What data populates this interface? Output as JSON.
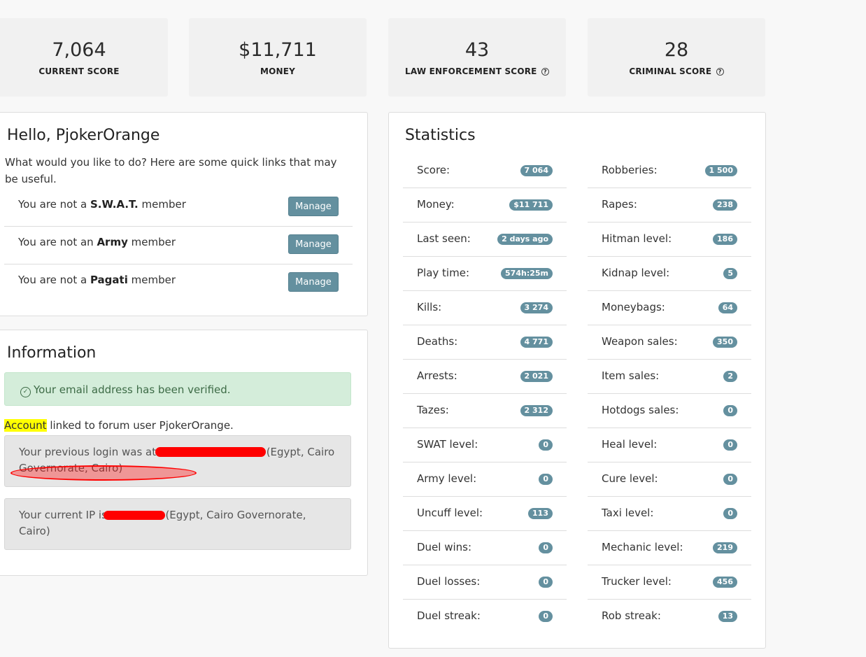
{
  "cards": [
    {
      "value": "7,064",
      "label": "CURRENT SCORE"
    },
    {
      "value": "$11,711",
      "label": "MONEY"
    },
    {
      "value": "43",
      "label": "LAW ENFORCEMENT SCORE"
    },
    {
      "value": "28",
      "label": "CRIMINAL SCORE"
    }
  ],
  "help_glyph": "?",
  "hello": {
    "title": "Hello, PjokerOrange",
    "subtitle": "What would you like to do? Here are some quick links that may be useful.",
    "memberships": [
      {
        "prefix": "You are not a ",
        "group": "S.W.A.T.",
        "suffix": " member",
        "button": "Manage"
      },
      {
        "prefix": "You are not an ",
        "group": "Army",
        "suffix": " member",
        "button": "Manage"
      },
      {
        "prefix": "You are not a ",
        "group": "Pagati",
        "suffix": " member",
        "button": "Manage"
      }
    ]
  },
  "information": {
    "title": "Information",
    "verified_text": "Your email address has been verified.",
    "account_word": "Account",
    "linked_text": " linked to forum user PjokerOrange.",
    "previous_login_prefix": "Your previous login was at",
    "previous_login_suffix": "(Egypt, Cairo Governorate, Cairo)",
    "current_ip_prefix": "Your current IP is",
    "current_ip_suffix": "(Egypt, Cairo Governorate, Cairo)"
  },
  "statistics": {
    "title": "Statistics",
    "left": [
      {
        "label": "Score:",
        "value": "7 064"
      },
      {
        "label": "Money:",
        "value": "$11 711"
      },
      {
        "label": "Last seen:",
        "value": "2 days ago"
      },
      {
        "label": "Play time:",
        "value": "574h:25m"
      },
      {
        "label": "Kills:",
        "value": "3 274"
      },
      {
        "label": "Deaths:",
        "value": "4 771"
      },
      {
        "label": "Arrests:",
        "value": "2 021"
      },
      {
        "label": "Tazes:",
        "value": "2 312"
      },
      {
        "label": "SWAT level:",
        "value": "0"
      },
      {
        "label": "Army level:",
        "value": "0"
      },
      {
        "label": "Uncuff level:",
        "value": "113"
      },
      {
        "label": "Duel wins:",
        "value": "0"
      },
      {
        "label": "Duel losses:",
        "value": "0"
      },
      {
        "label": "Duel streak:",
        "value": "0"
      }
    ],
    "right": [
      {
        "label": "Robberies:",
        "value": "1 500"
      },
      {
        "label": "Rapes:",
        "value": "238"
      },
      {
        "label": "Hitman level:",
        "value": "186"
      },
      {
        "label": "Kidnap level:",
        "value": "5"
      },
      {
        "label": "Moneybags:",
        "value": "64"
      },
      {
        "label": "Weapon sales:",
        "value": "350"
      },
      {
        "label": "Item sales:",
        "value": "2"
      },
      {
        "label": "Hotdogs sales:",
        "value": "0"
      },
      {
        "label": "Heal level:",
        "value": "0"
      },
      {
        "label": "Cure level:",
        "value": "0"
      },
      {
        "label": "Taxi level:",
        "value": "0"
      },
      {
        "label": "Mechanic level:",
        "value": "219"
      },
      {
        "label": "Trucker level:",
        "value": "456"
      },
      {
        "label": "Rob streak:",
        "value": "13"
      }
    ]
  },
  "colors": {
    "badge": "#64909f",
    "button": "#64909f",
    "success_bg": "#d4edda",
    "redaction": "#ff0000"
  }
}
